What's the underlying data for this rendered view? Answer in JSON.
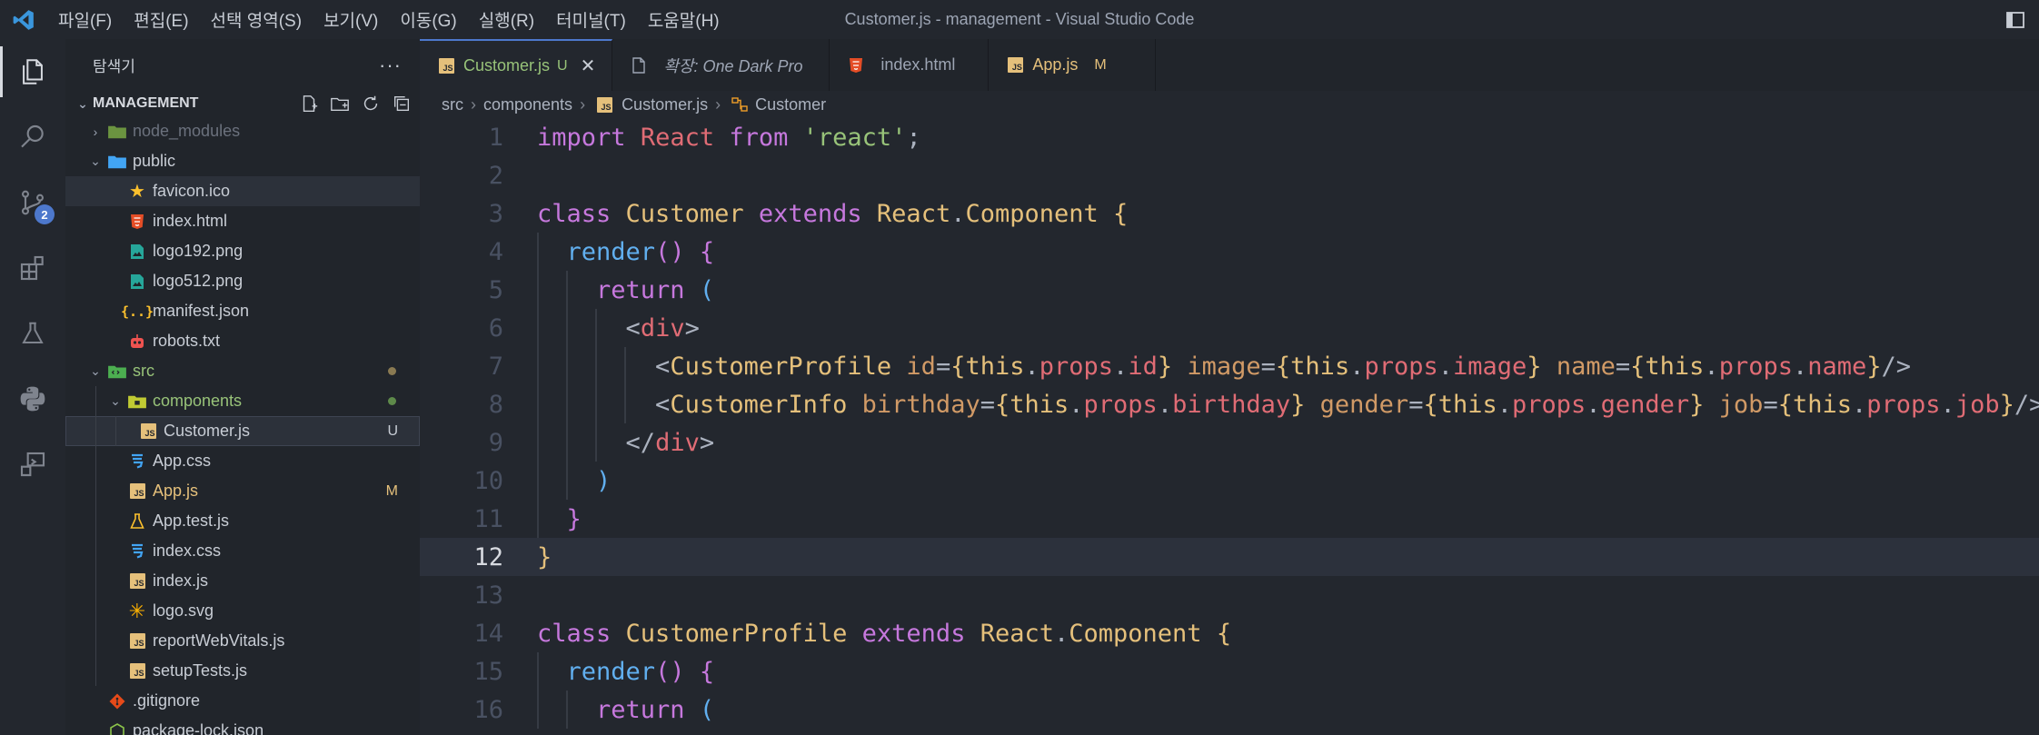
{
  "titlebar": {
    "menu": [
      "파일(F)",
      "편집(E)",
      "선택 영역(S)",
      "보기(V)",
      "이동(G)",
      "실행(R)",
      "터미널(T)",
      "도움말(H)"
    ],
    "window_title": "Customer.js - management - Visual Studio Code"
  },
  "activitybar": {
    "items": [
      "explorer-icon",
      "search-icon",
      "source-control-icon",
      "extensions-icon",
      "testing-icon",
      "python-icon",
      "remote-explorer-icon"
    ],
    "scm_badge": "2"
  },
  "sidebar": {
    "title": "탐색기",
    "more": "···",
    "section": "MANAGEMENT",
    "tree": [
      {
        "name": "node_modules",
        "kind": "folder"
      },
      {
        "name": "public",
        "kind": "folder"
      },
      {
        "name": "favicon.ico",
        "kind": "file"
      },
      {
        "name": "index.html",
        "kind": "file"
      },
      {
        "name": "logo192.png",
        "kind": "file"
      },
      {
        "name": "logo512.png",
        "kind": "file"
      },
      {
        "name": "manifest.json",
        "kind": "file"
      },
      {
        "name": "robots.txt",
        "kind": "file"
      },
      {
        "name": "src",
        "kind": "folder"
      },
      {
        "name": "components",
        "kind": "folder"
      },
      {
        "name": "Customer.js",
        "kind": "file",
        "status": "U"
      },
      {
        "name": "App.css",
        "kind": "file"
      },
      {
        "name": "App.js",
        "kind": "file",
        "status": "M"
      },
      {
        "name": "App.test.js",
        "kind": "file"
      },
      {
        "name": "index.css",
        "kind": "file"
      },
      {
        "name": "index.js",
        "kind": "file"
      },
      {
        "name": "logo.svg",
        "kind": "file"
      },
      {
        "name": "reportWebVitals.js",
        "kind": "file"
      },
      {
        "name": "setupTests.js",
        "kind": "file"
      },
      {
        "name": ".gitignore",
        "kind": "file"
      },
      {
        "name": "package-lock.json",
        "kind": "file"
      }
    ]
  },
  "tabs": [
    {
      "label": "Customer.js",
      "status": "U",
      "close": "✕"
    },
    {
      "label": "확장: One Dark Pro"
    },
    {
      "label": "index.html"
    },
    {
      "label": "App.js",
      "status": "M"
    }
  ],
  "breadcrumb": [
    "src",
    "components",
    "Customer.js",
    "Customer"
  ],
  "editor": {
    "current_line": 12,
    "lines": [
      {
        "n": "1",
        "text": "import React from 'react';"
      },
      {
        "n": "2",
        "text": ""
      },
      {
        "n": "3",
        "text": "class Customer extends React.Component {"
      },
      {
        "n": "4",
        "text": "  render() {"
      },
      {
        "n": "5",
        "text": "    return ("
      },
      {
        "n": "6",
        "text": "      <div>"
      },
      {
        "n": "7",
        "text": "        <CustomerProfile id={this.props.id} image={this.props.image} name={this.props.name}/>"
      },
      {
        "n": "8",
        "text": "        <CustomerInfo birthday={this.props.birthday} gender={this.props.gender} job={this.props.job}/>"
      },
      {
        "n": "9",
        "text": "      </div>"
      },
      {
        "n": "10",
        "text": "    )"
      },
      {
        "n": "11",
        "text": "  }"
      },
      {
        "n": "12",
        "text": "}"
      },
      {
        "n": "13",
        "text": ""
      },
      {
        "n": "14",
        "text": "class CustomerProfile extends React.Component {"
      },
      {
        "n": "15",
        "text": "  render() {"
      },
      {
        "n": "16",
        "text": "    return ("
      }
    ]
  },
  "colors": {
    "accent": "#4d78cc",
    "untracked": "#98c379",
    "modified": "#e5c07b",
    "keyword": "#c678dd",
    "class": "#e5c07b",
    "string": "#98c379",
    "function": "#61afef",
    "tag": "#e06c75"
  }
}
